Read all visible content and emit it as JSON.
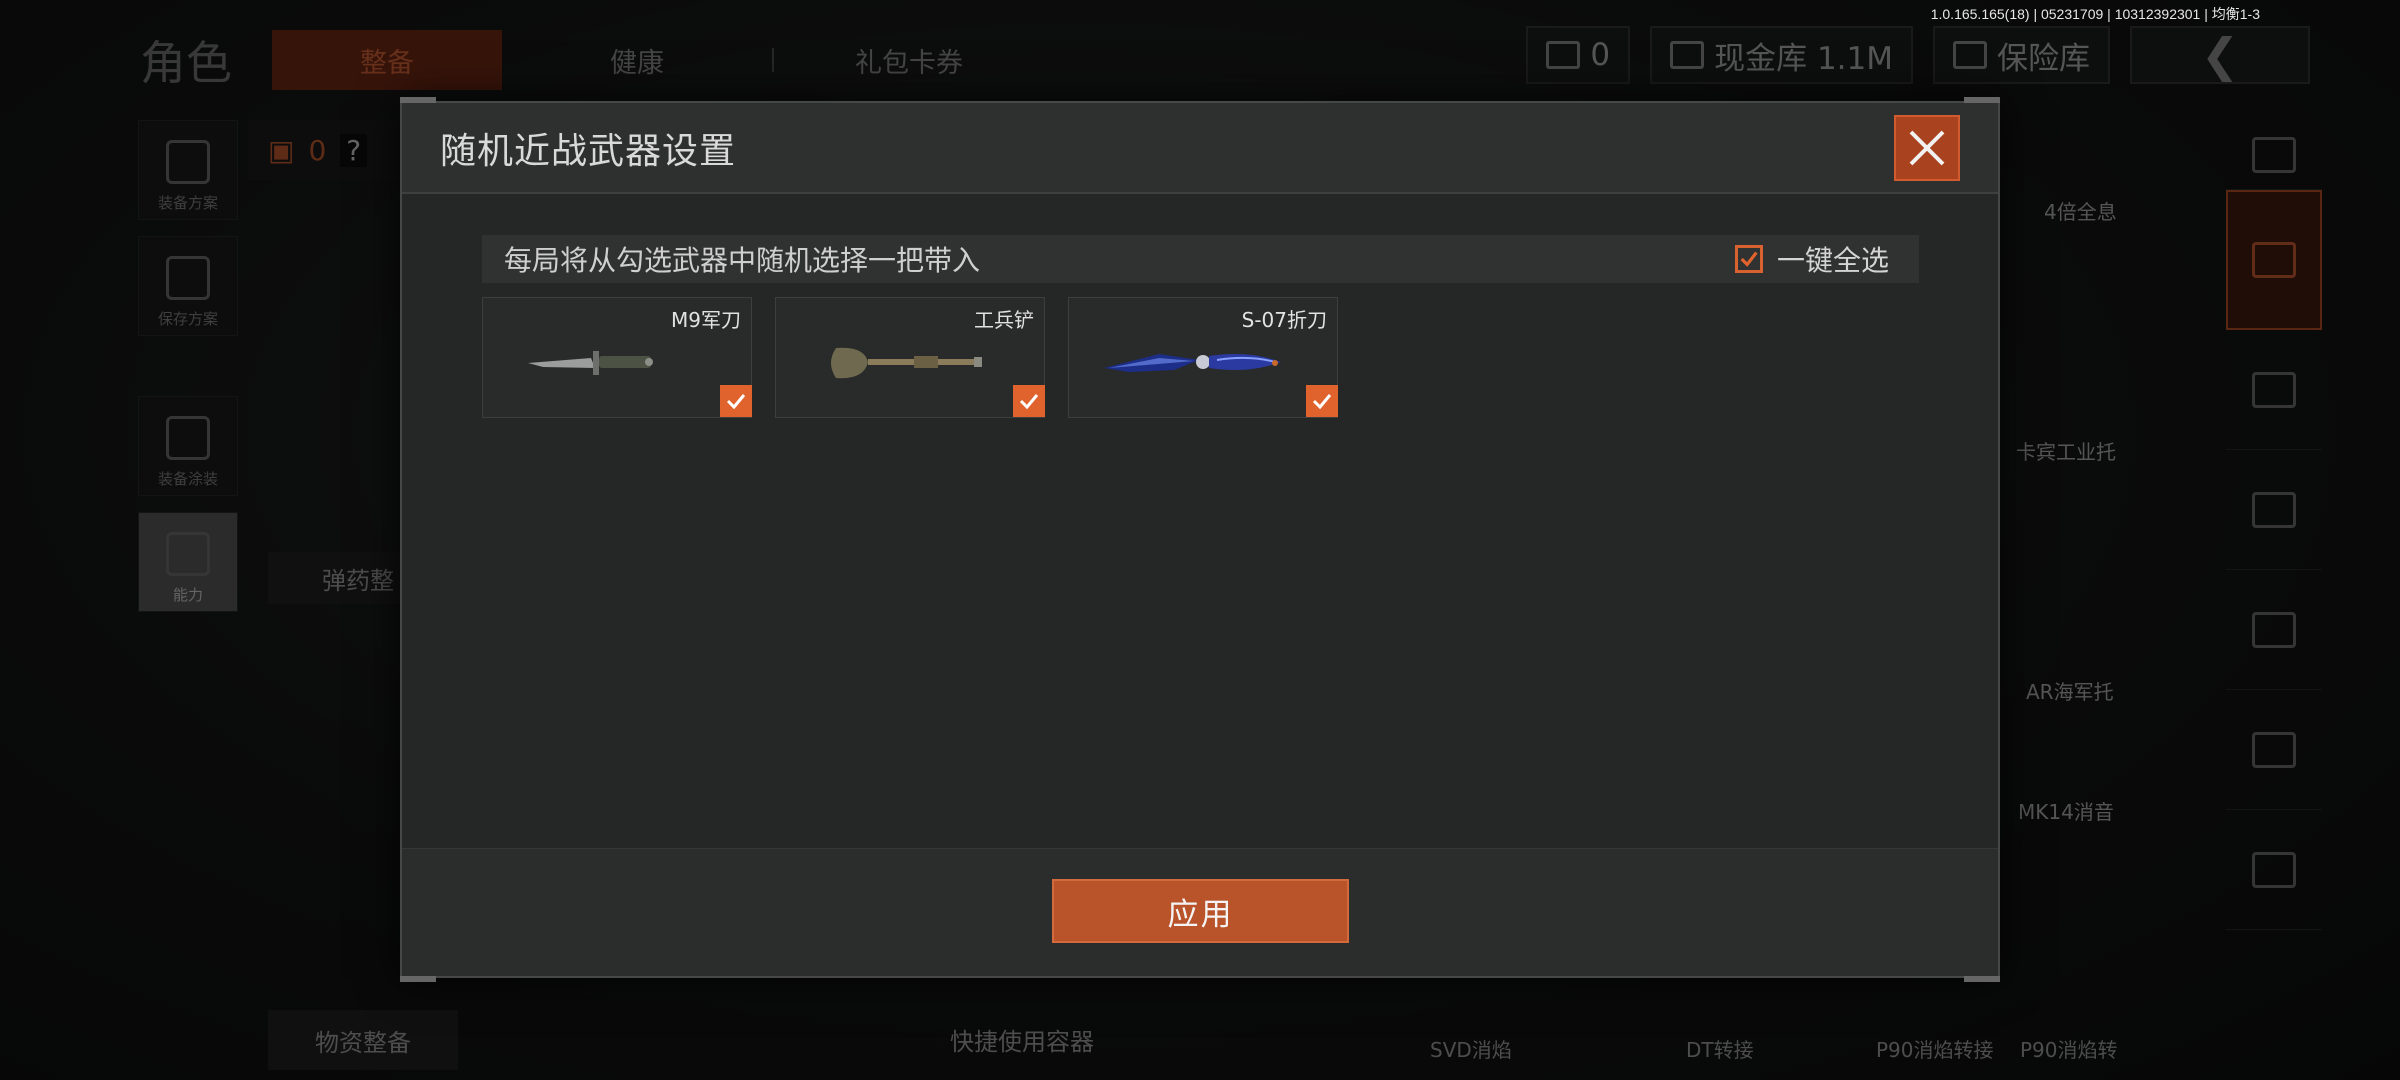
{
  "version": "1.0.165.165(18) | 05231709 | 10312392301 | 均衡1-3",
  "background": {
    "nav_title": "角色",
    "tabs": [
      {
        "label": "整备",
        "active": true
      },
      {
        "label": "健康",
        "active": false
      },
      {
        "label": "礼包卡券",
        "active": false
      }
    ],
    "currency_count": "0",
    "cash_vault": "现金库 1.1M",
    "safe_box": "保险库",
    "back_glyph": "❮",
    "rail": [
      {
        "label": "装备方案"
      },
      {
        "label": "保存方案"
      },
      {
        "label": "装备涂装"
      },
      {
        "label": "能力"
      }
    ],
    "backpack_count": "0",
    "help_glyph": "?",
    "ammo_label": "弹药整",
    "supplies_label": "物资整备",
    "quick_container": "快捷使用容器",
    "right_labels": [
      "4倍全息",
      "卡宾工业托",
      "AR海军托",
      "MK14消音"
    ],
    "bottom_labels": [
      "SVD消焰",
      "DT转接",
      "P90消焰转接",
      "P90消焰转"
    ]
  },
  "modal": {
    "title": "随机近战武器设置",
    "close_icon": "close-icon",
    "info_text": "每局将从勾选武器中随机选择一把带入",
    "select_all_label": "一键全选",
    "select_all_checked": true,
    "accent_color": "#e0622c",
    "weapons": [
      {
        "name": "M9军刀",
        "checked": true
      },
      {
        "name": "工兵铲",
        "checked": true
      },
      {
        "name": "S-07折刀",
        "checked": true
      }
    ],
    "apply_label": "应用"
  }
}
